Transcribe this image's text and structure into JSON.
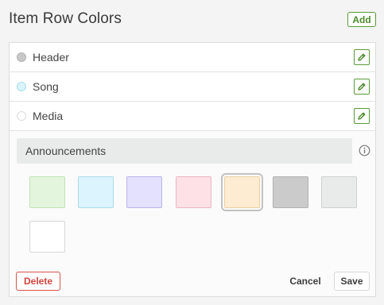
{
  "header": {
    "title": "Item Row Colors",
    "add_label": "Add"
  },
  "rows": [
    {
      "label": "Header",
      "color": "#c8c8c8",
      "border": "#b4b4b4",
      "icon": "pencil-icon"
    },
    {
      "label": "Song",
      "color": "#d9f4fc",
      "border": "#a9dff0",
      "icon": "pencil-icon"
    },
    {
      "label": "Media",
      "color": "#ffffff",
      "border": "#dddddd",
      "icon": "pencil-icon"
    }
  ],
  "editor": {
    "name_value": "Announcements",
    "info_icon": "info-icon",
    "swatches": [
      {
        "color": "#e3f6dd",
        "border": "#bfe3b2",
        "selected": false
      },
      {
        "color": "#dcf4fd",
        "border": "#a9dcec",
        "selected": false
      },
      {
        "color": "#e3e1fd",
        "border": "#b9b4ea",
        "selected": false
      },
      {
        "color": "#fde1e7",
        "border": "#efb4c2",
        "selected": false
      },
      {
        "color": "#fdebd2",
        "border": "#eccfa4",
        "selected": true
      },
      {
        "color": "#cbcbcb",
        "border": "#b1b1b1",
        "selected": false
      },
      {
        "color": "#e9eaea",
        "border": "#cfcfcf",
        "selected": false
      },
      {
        "color": "#ffffff",
        "border": "#d6d6d6",
        "selected": false
      }
    ],
    "delete_label": "Delete",
    "cancel_label": "Cancel",
    "save_label": "Save"
  },
  "colors": {
    "accent_green": "#5a9a36",
    "danger_red": "#d9534f"
  }
}
